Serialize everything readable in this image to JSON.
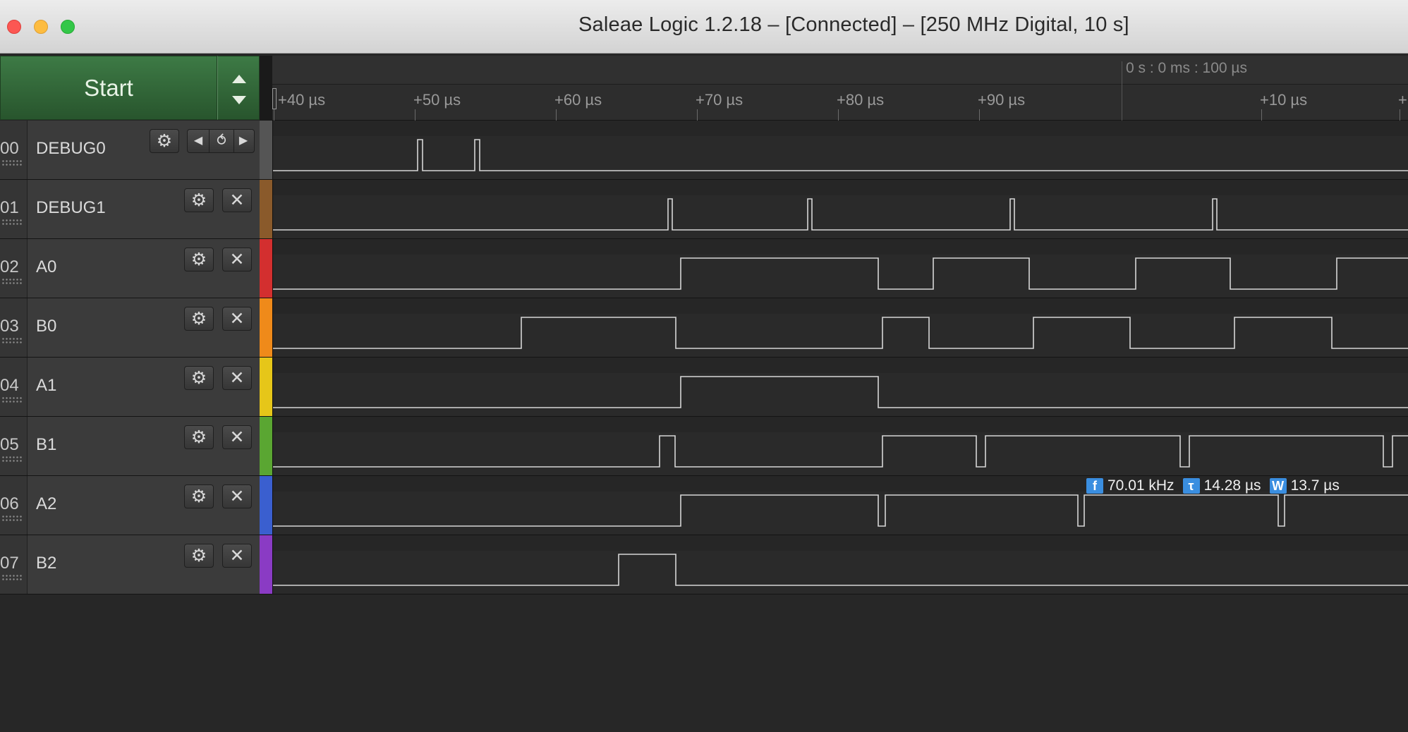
{
  "window": {
    "title": "Saleae Logic 1.2.18 – [Connected] – [250 MHz Digital, 10 s]"
  },
  "controls": {
    "start_label": "Start"
  },
  "ruler": {
    "center_time": "0 s : 0 ms : 100 µs",
    "ticks": [
      "+40 µs",
      "+50 µs",
      "+60 µs",
      "+70 µs",
      "+80 µs",
      "+90 µs",
      "+10 µs",
      "+"
    ]
  },
  "channels": [
    {
      "num": "00",
      "name": "DEBUG0",
      "color": "#555555",
      "buttons": "trigger"
    },
    {
      "num": "01",
      "name": "DEBUG1",
      "color": "#8a5a2b",
      "buttons": "close"
    },
    {
      "num": "02",
      "name": "A0",
      "color": "#d32f2f",
      "buttons": "close"
    },
    {
      "num": "03",
      "name": "B0",
      "color": "#ef8a1a",
      "buttons": "close"
    },
    {
      "num": "04",
      "name": "A1",
      "color": "#e6c619",
      "buttons": "close"
    },
    {
      "num": "05",
      "name": "B1",
      "color": "#5aa632",
      "buttons": "close"
    },
    {
      "num": "06",
      "name": "A2",
      "color": "#3a5fcf",
      "buttons": "close"
    },
    {
      "num": "07",
      "name": "B2",
      "color": "#8a3bc4",
      "buttons": "close"
    }
  ],
  "measurement": {
    "freq_icon": "f",
    "freq": "70.01 kHz",
    "period_icon": "τ",
    "period": "14.28 µs",
    "width_icon": "W",
    "width": "13.7 µs"
  },
  "icons": {
    "gear": "gear-icon",
    "close": "close-icon",
    "prev": "prev-edge-icon",
    "trigger": "trigger-edge-icon",
    "next": "next-edge-icon",
    "up": "arrow-up-icon",
    "down": "arrow-down-icon"
  }
}
